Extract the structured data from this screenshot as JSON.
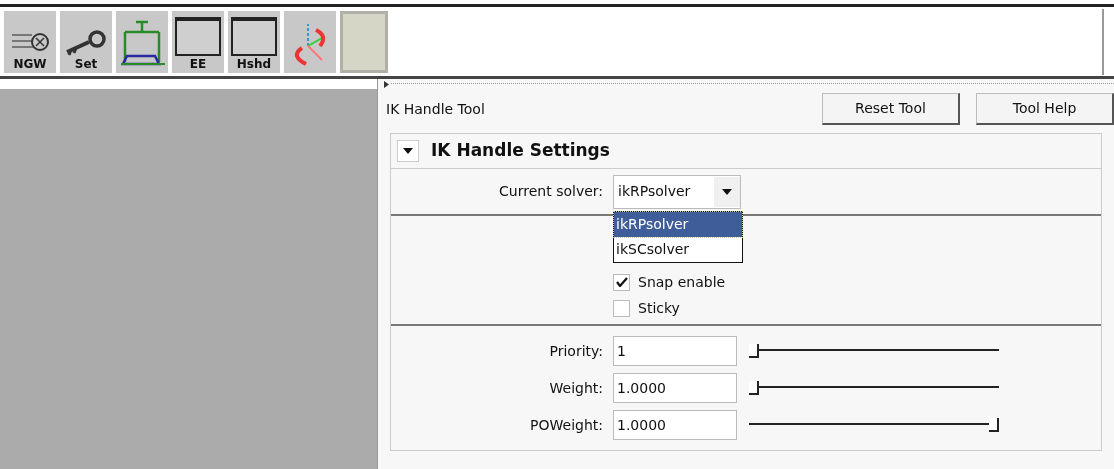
{
  "shelf": [
    {
      "kind": "logo",
      "label": "NGW"
    },
    {
      "kind": "key",
      "label": "Set"
    },
    {
      "kind": "ik"
    },
    {
      "kind": "blank",
      "label": "EE"
    },
    {
      "kind": "blank",
      "label": "Hshd"
    },
    {
      "kind": "axes"
    },
    {
      "kind": "empty"
    }
  ],
  "tool": {
    "title": "IK Handle Tool",
    "buttons": [
      "Reset Tool",
      "Tool Help"
    ]
  },
  "section": {
    "title": "IK Handle Settings",
    "expanded": true,
    "solver": {
      "label": "Current solver:",
      "value": "ikRPsolver",
      "options": [
        {
          "label": "ikRPsolver",
          "selected": true
        },
        {
          "label": "ikSCsolver",
          "selected": false
        }
      ]
    },
    "checkboxes": [
      {
        "label": "Snap enable",
        "checked": true
      },
      {
        "label": "Sticky",
        "checked": false
      }
    ],
    "sliders": [
      {
        "label": "Priority:",
        "value": "1",
        "level": 0
      },
      {
        "label": "Weight:",
        "value": "1.0000",
        "level": 0
      },
      {
        "label": "POWeight:",
        "value": "1.0000",
        "level": 1
      }
    ]
  }
}
